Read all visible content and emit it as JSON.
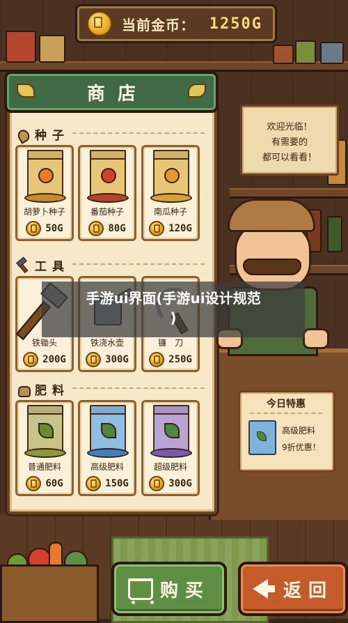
{
  "header": {
    "coin_label": "当前金币：",
    "coin_amount": "1250G",
    "coin_icon": "gold-coin-icon"
  },
  "shop": {
    "title": "商店",
    "sections": [
      {
        "name": "种子",
        "icon": "seed-icon",
        "items": [
          {
            "name": "胡萝卜种子",
            "price": "50G",
            "bag_color": "#e7c777",
            "accent": "#e77b2a"
          },
          {
            "name": "番茄种子",
            "price": "80G",
            "bag_color": "#e7c777",
            "accent": "#d2402a"
          },
          {
            "name": "南瓜种子",
            "price": "120G",
            "bag_color": "#e7c777",
            "accent": "#e9962e"
          }
        ]
      },
      {
        "name": "工具",
        "icon": "hammer-icon",
        "items": [
          {
            "name": "铁锄头",
            "price": "200G",
            "icon": "hoe-icon"
          },
          {
            "name": "铁浇水壶",
            "price": "300G",
            "icon": "watering-can-icon"
          },
          {
            "name": "镰　刀",
            "price": "250G",
            "icon": "sickle-icon"
          }
        ]
      },
      {
        "name": "肥料",
        "icon": "fertilizer-sack-icon",
        "items": [
          {
            "name": "普通肥料",
            "price": "60G",
            "bag_color": "#c7c48a",
            "accent": "#6a8a2f"
          },
          {
            "name": "高级肥料",
            "price": "150G",
            "bag_color": "#8fbde3",
            "accent": "#3f7fc0"
          },
          {
            "name": "超级肥料",
            "price": "300G",
            "bag_color": "#b9a4d6",
            "accent": "#7a5ab0"
          }
        ]
      }
    ]
  },
  "welcome_sign": {
    "lines": [
      "欢迎光临！",
      "有需要的",
      "都可以看看！"
    ]
  },
  "special": {
    "title": "今日特惠",
    "item": "高级肥料",
    "discount": "9折优惠！"
  },
  "buttons": {
    "buy": "购买",
    "back": "返回"
  },
  "watermark": {
    "line1": "手游ui界面(手游ui设计规范",
    "line2": ")"
  },
  "colors": {
    "panel": "#f6e8c8",
    "banner": "#3f6a45",
    "buy_button": "#5f8e47",
    "back_button": "#c55b2b",
    "coin": "#e7a91f"
  }
}
